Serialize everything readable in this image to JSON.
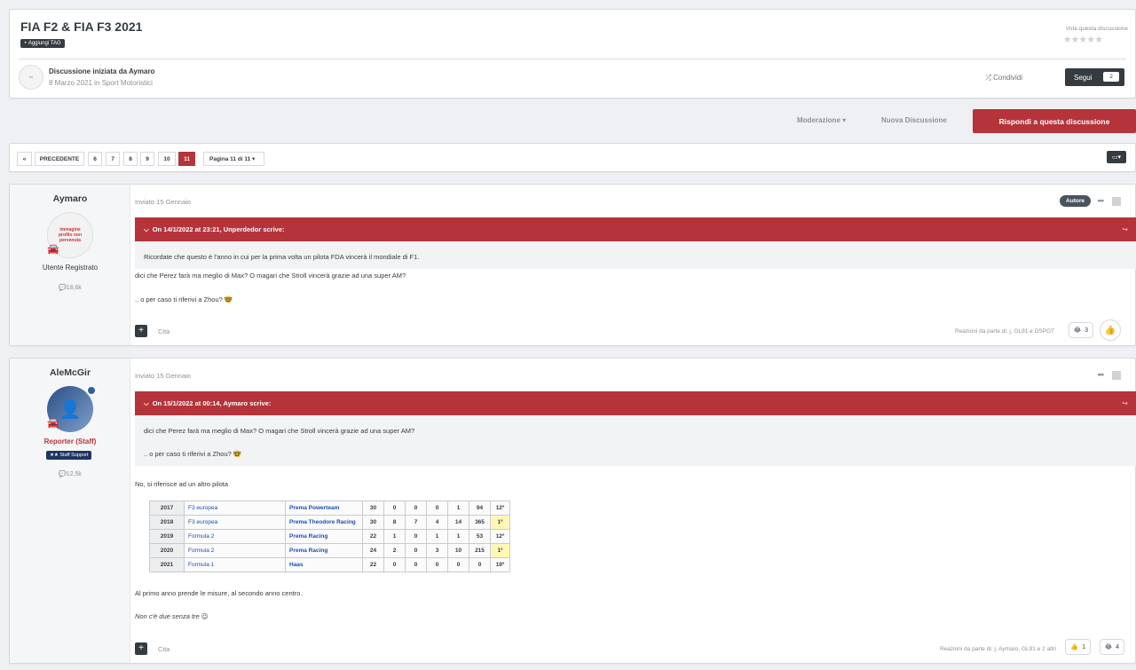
{
  "header": {
    "title": "FIA F2 & FIA F3 2021",
    "tag_button": "+ Aggiungi TAG",
    "rate_label": "Vota questa discussione",
    "stars": "★★★★★",
    "started_by": "Discussione iniziata da Aymaro",
    "started_meta": "8 Marzo 2021 in Sport Motoristici",
    "share_label": "Condividi",
    "follow_label": "Segui",
    "follow_count": "2"
  },
  "actions": {
    "moderation": "Moderazione ▾",
    "new_discussion": "Nuova Discussione",
    "reply": "Rispondi a questa discussione"
  },
  "pagination": {
    "first": "«",
    "prev": "PRECEDENTE",
    "pages": [
      "6",
      "7",
      "8",
      "9",
      "10",
      "11"
    ],
    "active": "11",
    "page_select": "Pagina 11 di 11 ▾"
  },
  "posts": [
    {
      "author": "Aymaro",
      "group": "Utente Registrato",
      "post_count": "18,6k",
      "avatar_text": "immagine profilo non pervenuta",
      "date": "Inviato 15 Gennaio",
      "author_badge": "Autore",
      "quote_head": "On 14/1/2022 at 23:21, Unperdedor scrive:",
      "quote_lines": [
        "Ricordate che questo è l'anno in cui per la prima volta un pilota FDA vincerà il mondiale di F1."
      ],
      "body_lines": [
        "dici che Perez farà ma meglio di Max? O magari che Stroll vincerà grazie ad una super AM?",
        ".. o per caso ti riferivi a Zhou? 🤓"
      ],
      "cite": "Cita",
      "reactions_label": "Reazioni da parte di: j, GL91 e DSPGT",
      "reactions": [
        {
          "emoji": "😂",
          "count": "3"
        }
      ]
    },
    {
      "author": "AleMcGir",
      "group": "Reporter (Staff)",
      "staff_badge": "★★ Staff Support",
      "post_count": "12,5k",
      "date": "Inviato 15 Gennaio",
      "quote_head": "On 15/1/2022 at 00:14, Aymaro scrive:",
      "quote_lines": [
        "dici che Perez farà ma meglio di Max? O magari che Stroll vincerà grazie ad una super AM?",
        ".. o per caso ti riferivi a Zhou? 🤓"
      ],
      "body_intro": "No, si riferisce ad un altro pilota",
      "table": [
        {
          "year": "2017",
          "series": "F3 europea",
          "team": "Prema Powerteam",
          "c1": "30",
          "c2": "0",
          "c3": "0",
          "c4": "0",
          "c5": "1",
          "c6": "94",
          "pos": "12º",
          "champ": false
        },
        {
          "year": "2018",
          "series": "F3 europea",
          "team": "Prema Theodore Racing",
          "c1": "30",
          "c2": "8",
          "c3": "7",
          "c4": "4",
          "c5": "14",
          "c6": "365",
          "pos": "1º",
          "champ": true
        },
        {
          "year": "2019",
          "series": "Formula 2",
          "team": "Prema Racing",
          "c1": "22",
          "c2": "1",
          "c3": "0",
          "c4": "1",
          "c5": "1",
          "c6": "53",
          "pos": "12º",
          "champ": false
        },
        {
          "year": "2020",
          "series": "Formula 2",
          "team": "Prema Racing",
          "c1": "24",
          "c2": "2",
          "c3": "0",
          "c4": "3",
          "c5": "10",
          "c6": "215",
          "pos": "1º",
          "champ": true
        },
        {
          "year": "2021",
          "series": "Formula 1",
          "team": "Haas",
          "c1": "22",
          "c2": "0",
          "c3": "0",
          "c4": "0",
          "c5": "0",
          "c6": "0",
          "pos": "19º",
          "champ": false
        }
      ],
      "body_after_1": "Al primo anno prende le misure, al secondo anno centro.",
      "body_after_2": "Non c'è due senza tre 😉",
      "cite": "Cita",
      "reactions_label": "Reazioni da parte di: j, Aymaro, GL91 e 2 altri",
      "reactions": [
        {
          "emoji": "👍",
          "count": "1"
        },
        {
          "emoji": "😂",
          "count": "4"
        }
      ]
    }
  ],
  "colors": {
    "accent": "#b5333a",
    "dark": "#353c41",
    "muted": "#8a9299"
  }
}
